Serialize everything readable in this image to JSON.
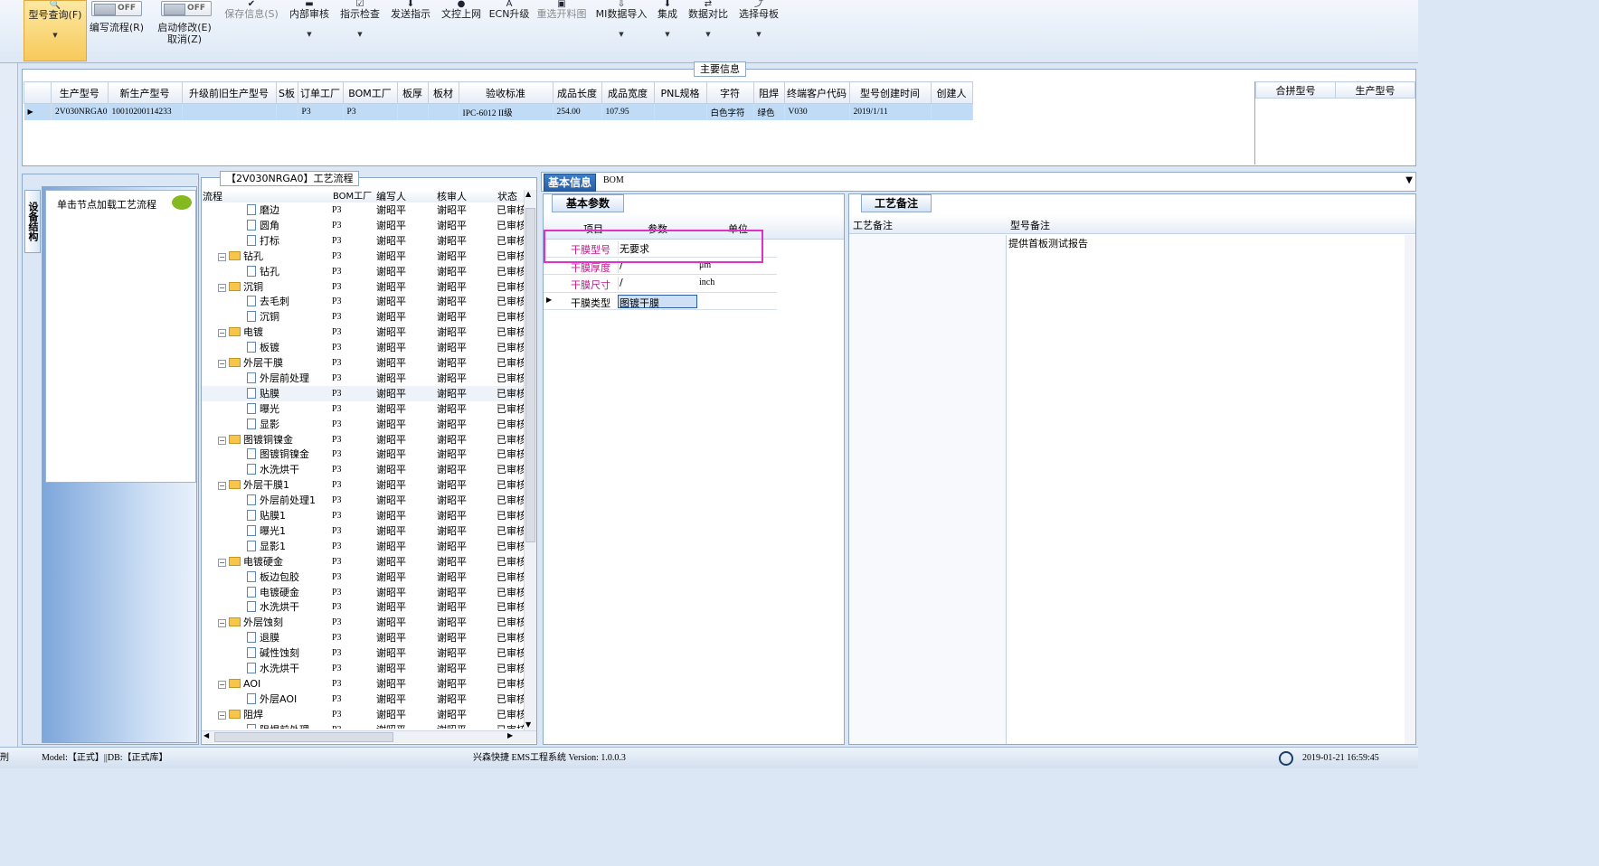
{
  "toolbar": {
    "items": [
      {
        "label": "型号查询(F)",
        "icon": "search-icon"
      },
      {
        "label": "编写流程(R)",
        "toggle": "OFF"
      },
      {
        "label": "启动修改(E)",
        "label2": "取消(Z)",
        "toggle": "OFF"
      },
      {
        "label": "保存信息(S)",
        "icon": "check-icon"
      },
      {
        "label": "内部审核",
        "icon": "print-icon"
      },
      {
        "label": "指示检查",
        "icon": "checkbox-icon"
      },
      {
        "label": "发送指示",
        "icon": "download-icon"
      },
      {
        "label": "文控上网",
        "icon": "lock-icon"
      },
      {
        "label": "ECN升级",
        "icon": "text-a-icon"
      },
      {
        "label": "重选开料图",
        "icon": "image-icon"
      },
      {
        "label": "MI数据导入",
        "icon": "import-icon"
      },
      {
        "label": "集成",
        "icon": "download-icon"
      },
      {
        "label": "数据对比",
        "icon": "compare-icon"
      },
      {
        "label": "选择母板",
        "icon": "select-icon"
      }
    ]
  },
  "main_info": {
    "caption": "主要信息",
    "columns": [
      "生产型号",
      "新生产型号",
      "升级前旧生产型号",
      "S板",
      "订单工厂",
      "BOM工厂",
      "板厚",
      "板材",
      "验收标准",
      "成品长度",
      "成品宽度",
      "PNL规格",
      "字符",
      "阻焊",
      "终端客户代码",
      "型号创建时间",
      "创建人"
    ],
    "row": [
      "2V030NRGA0",
      "10010200114233",
      "",
      "",
      "P3",
      "P3",
      "",
      "",
      "IPC-6012 II级",
      "254.00",
      "107.95",
      "",
      "白色字符",
      "绿色",
      "V030",
      "2019/1/11",
      ""
    ],
    "right_columns": [
      "合拼型号",
      "生产型号"
    ]
  },
  "left_panel": {
    "vtab": "设备结构",
    "hint": "单击节点加载工艺流程"
  },
  "flow": {
    "caption": "【2V030NRGA0】工艺流程",
    "columns": [
      "流程",
      "BOM工厂",
      "编写人",
      "核审人",
      "状态"
    ],
    "rows": [
      {
        "name": "磨边",
        "level": 2,
        "bom": "P3",
        "writer": "谢昭平",
        "reviewer": "谢昭平",
        "status": "已审核"
      },
      {
        "name": "圆角",
        "level": 2,
        "bom": "P3",
        "writer": "谢昭平",
        "reviewer": "谢昭平",
        "status": "已审核"
      },
      {
        "name": "打标",
        "level": 2,
        "bom": "P3",
        "writer": "谢昭平",
        "reviewer": "谢昭平",
        "status": "已审核"
      },
      {
        "name": "钻孔",
        "level": 1,
        "bom": "P3",
        "writer": "谢昭平",
        "reviewer": "谢昭平",
        "status": "已审核"
      },
      {
        "name": "钻孔",
        "level": 2,
        "bom": "P3",
        "writer": "谢昭平",
        "reviewer": "谢昭平",
        "status": "已审核"
      },
      {
        "name": "沉铜",
        "level": 1,
        "bom": "P3",
        "writer": "谢昭平",
        "reviewer": "谢昭平",
        "status": "已审核"
      },
      {
        "name": "去毛刺",
        "level": 2,
        "bom": "P3",
        "writer": "谢昭平",
        "reviewer": "谢昭平",
        "status": "已审核"
      },
      {
        "name": "沉铜",
        "level": 2,
        "bom": "P3",
        "writer": "谢昭平",
        "reviewer": "谢昭平",
        "status": "已审核"
      },
      {
        "name": "电镀",
        "level": 1,
        "bom": "P3",
        "writer": "谢昭平",
        "reviewer": "谢昭平",
        "status": "已审核"
      },
      {
        "name": "板镀",
        "level": 2,
        "bom": "P3",
        "writer": "谢昭平",
        "reviewer": "谢昭平",
        "status": "已审核"
      },
      {
        "name": "外层干膜",
        "level": 1,
        "bom": "P3",
        "writer": "谢昭平",
        "reviewer": "谢昭平",
        "status": "已审核"
      },
      {
        "name": "外层前处理",
        "level": 2,
        "bom": "P3",
        "writer": "谢昭平",
        "reviewer": "谢昭平",
        "status": "已审核"
      },
      {
        "name": "贴膜",
        "level": 2,
        "bom": "P3",
        "writer": "谢昭平",
        "reviewer": "谢昭平",
        "status": "已审核"
      },
      {
        "name": "曝光",
        "level": 2,
        "bom": "P3",
        "writer": "谢昭平",
        "reviewer": "谢昭平",
        "status": "已审核"
      },
      {
        "name": "显影",
        "level": 2,
        "bom": "P3",
        "writer": "谢昭平",
        "reviewer": "谢昭平",
        "status": "已审核"
      },
      {
        "name": "图镀铜镍金",
        "level": 1,
        "bom": "P3",
        "writer": "谢昭平",
        "reviewer": "谢昭平",
        "status": "已审核"
      },
      {
        "name": "图镀铜镍金",
        "level": 2,
        "bom": "P3",
        "writer": "谢昭平",
        "reviewer": "谢昭平",
        "status": "已审核"
      },
      {
        "name": "水洗烘干",
        "level": 2,
        "bom": "P3",
        "writer": "谢昭平",
        "reviewer": "谢昭平",
        "status": "已审核"
      },
      {
        "name": "外层干膜1",
        "level": 1,
        "bom": "P3",
        "writer": "谢昭平",
        "reviewer": "谢昭平",
        "status": "已审核"
      },
      {
        "name": "外层前处理1",
        "level": 2,
        "bom": "P3",
        "writer": "谢昭平",
        "reviewer": "谢昭平",
        "status": "已审核"
      },
      {
        "name": "贴膜1",
        "level": 2,
        "bom": "P3",
        "writer": "谢昭平",
        "reviewer": "谢昭平",
        "status": "已审核"
      },
      {
        "name": "曝光1",
        "level": 2,
        "bom": "P3",
        "writer": "谢昭平",
        "reviewer": "谢昭平",
        "status": "已审核"
      },
      {
        "name": "显影1",
        "level": 2,
        "bom": "P3",
        "writer": "谢昭平",
        "reviewer": "谢昭平",
        "status": "已审核"
      },
      {
        "name": "电镀硬金",
        "level": 1,
        "bom": "P3",
        "writer": "谢昭平",
        "reviewer": "谢昭平",
        "status": "已审核"
      },
      {
        "name": "板边包胶",
        "level": 2,
        "bom": "P3",
        "writer": "谢昭平",
        "reviewer": "谢昭平",
        "status": "已审核"
      },
      {
        "name": "电镀硬金",
        "level": 2,
        "bom": "P3",
        "writer": "谢昭平",
        "reviewer": "谢昭平",
        "status": "已审核"
      },
      {
        "name": "水洗烘干",
        "level": 2,
        "bom": "P3",
        "writer": "谢昭平",
        "reviewer": "谢昭平",
        "status": "已审核"
      },
      {
        "name": "外层蚀刻",
        "level": 1,
        "bom": "P3",
        "writer": "谢昭平",
        "reviewer": "谢昭平",
        "status": "已审核"
      },
      {
        "name": "退膜",
        "level": 2,
        "bom": "P3",
        "writer": "谢昭平",
        "reviewer": "谢昭平",
        "status": "已审核"
      },
      {
        "name": "碱性蚀刻",
        "level": 2,
        "bom": "P3",
        "writer": "谢昭平",
        "reviewer": "谢昭平",
        "status": "已审核"
      },
      {
        "name": "水洗烘干",
        "level": 2,
        "bom": "P3",
        "writer": "谢昭平",
        "reviewer": "谢昭平",
        "status": "已审核"
      },
      {
        "name": "AOI",
        "level": 1,
        "bom": "P3",
        "writer": "谢昭平",
        "reviewer": "谢昭平",
        "status": "已审核"
      },
      {
        "name": "外层AOI",
        "level": 2,
        "bom": "P3",
        "writer": "谢昭平",
        "reviewer": "谢昭平",
        "status": "已审核"
      },
      {
        "name": "阻焊",
        "level": 1,
        "bom": "P3",
        "writer": "谢昭平",
        "reviewer": "谢昭平",
        "status": "已审核"
      },
      {
        "name": "阻焊前处理",
        "level": 2,
        "bom": "P3",
        "writer": "谢昭平",
        "reviewer": "谢昭平",
        "status": "已审核"
      }
    ]
  },
  "detail_tabs": [
    "基本信息",
    "BOM"
  ],
  "basic_params": {
    "tab": "基本参数",
    "columns": [
      "项目",
      "参数",
      "单位"
    ],
    "rows": [
      {
        "item": "干膜型号",
        "param": "无要求",
        "unit": ""
      },
      {
        "item": "干膜厚度",
        "param": "/",
        "unit": "μm"
      },
      {
        "item": "干膜尺寸",
        "param": "/",
        "unit": "inch"
      },
      {
        "item": "干膜类型",
        "param": "图镀干膜",
        "unit": ""
      }
    ]
  },
  "process_notes": {
    "tab": "工艺备注",
    "columns": [
      "工艺备注",
      "型号备注"
    ],
    "model_note": "提供首板测试报告"
  },
  "status_bar": {
    "model": "Model:【正式】||DB:【正式库】",
    "app": "兴森快捷 EMS工程系统 Version: 1.0.0.3",
    "datetime": "2019-01-21 16:59:45",
    "left_char": "刑"
  },
  "colors": {
    "accent": "#2760a8",
    "highlight": "#e030c8",
    "selected_row": "#bfdbf6"
  }
}
